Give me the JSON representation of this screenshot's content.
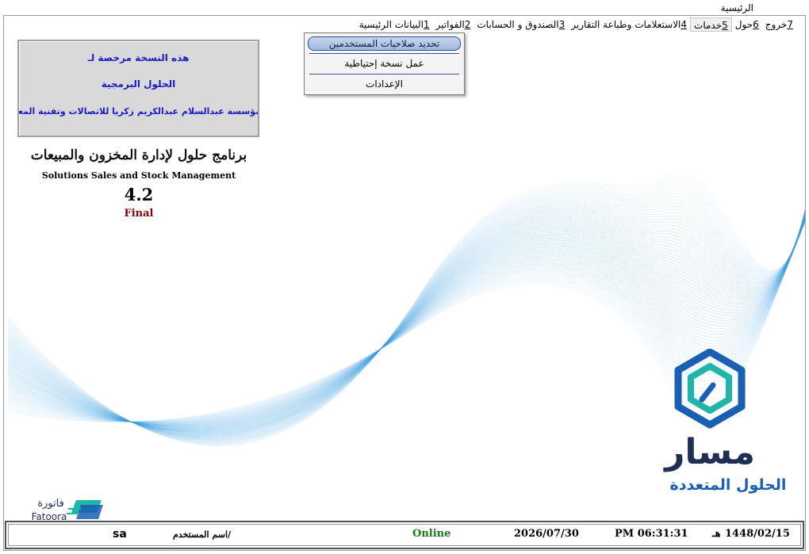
{
  "window": {
    "title": "الرئيسية"
  },
  "menu": [
    {
      "num": "1",
      "label": "البيانات الرئيسية"
    },
    {
      "num": "2",
      "label": "الفواتير"
    },
    {
      "num": "3",
      "label": "الصندوق و الحسابات"
    },
    {
      "num": "4",
      "label": "الاستعلامات وطباعة التقارير"
    },
    {
      "num": "5",
      "label": "خدمات"
    },
    {
      "num": "6",
      "label": "حول"
    },
    {
      "num": "7",
      "label": "خروج"
    }
  ],
  "services_menu": {
    "items": [
      "تحديد صلاحيات المستخدمين",
      "عمل نسخة إحتياطية",
      "الإعدادات"
    ]
  },
  "license": {
    "line1": "هذه النسخة مرخصة لـ",
    "line2": "الحلول البرمجية",
    "line3": "مؤسسة عبدالسلام عبدالكريم زكريا للاتصالات وتقنية المعلومات"
  },
  "program": {
    "name_ar": "برنامج حلول لإدارة المخزون والمبيعات",
    "name_en": "Solutions Sales and Stock Management",
    "version": "4.2",
    "edition": "Final"
  },
  "logos": {
    "masar_main": "مسار",
    "masar_sub": "الحلول المتعددة",
    "fatoora_ar": "فاتورة",
    "fatoora_en": "Fatoora"
  },
  "status": {
    "hijri_date": "1448/02/15",
    "hijri_suffix": "هـ",
    "time": "PM 06:31:31",
    "date": "2026/07/30",
    "connection": "Online",
    "username_label": "اسم المستخدم/",
    "username": "sa"
  },
  "colors": {
    "license_text": "#1c1ccc",
    "final_text": "#8b0000",
    "online_text": "#1a7a1a",
    "wave_blue": "#3a9ee0",
    "masar_teal": "#1fb5a8",
    "masar_blue": "#1a5fb4",
    "masar_navy": "#1e2e55"
  }
}
